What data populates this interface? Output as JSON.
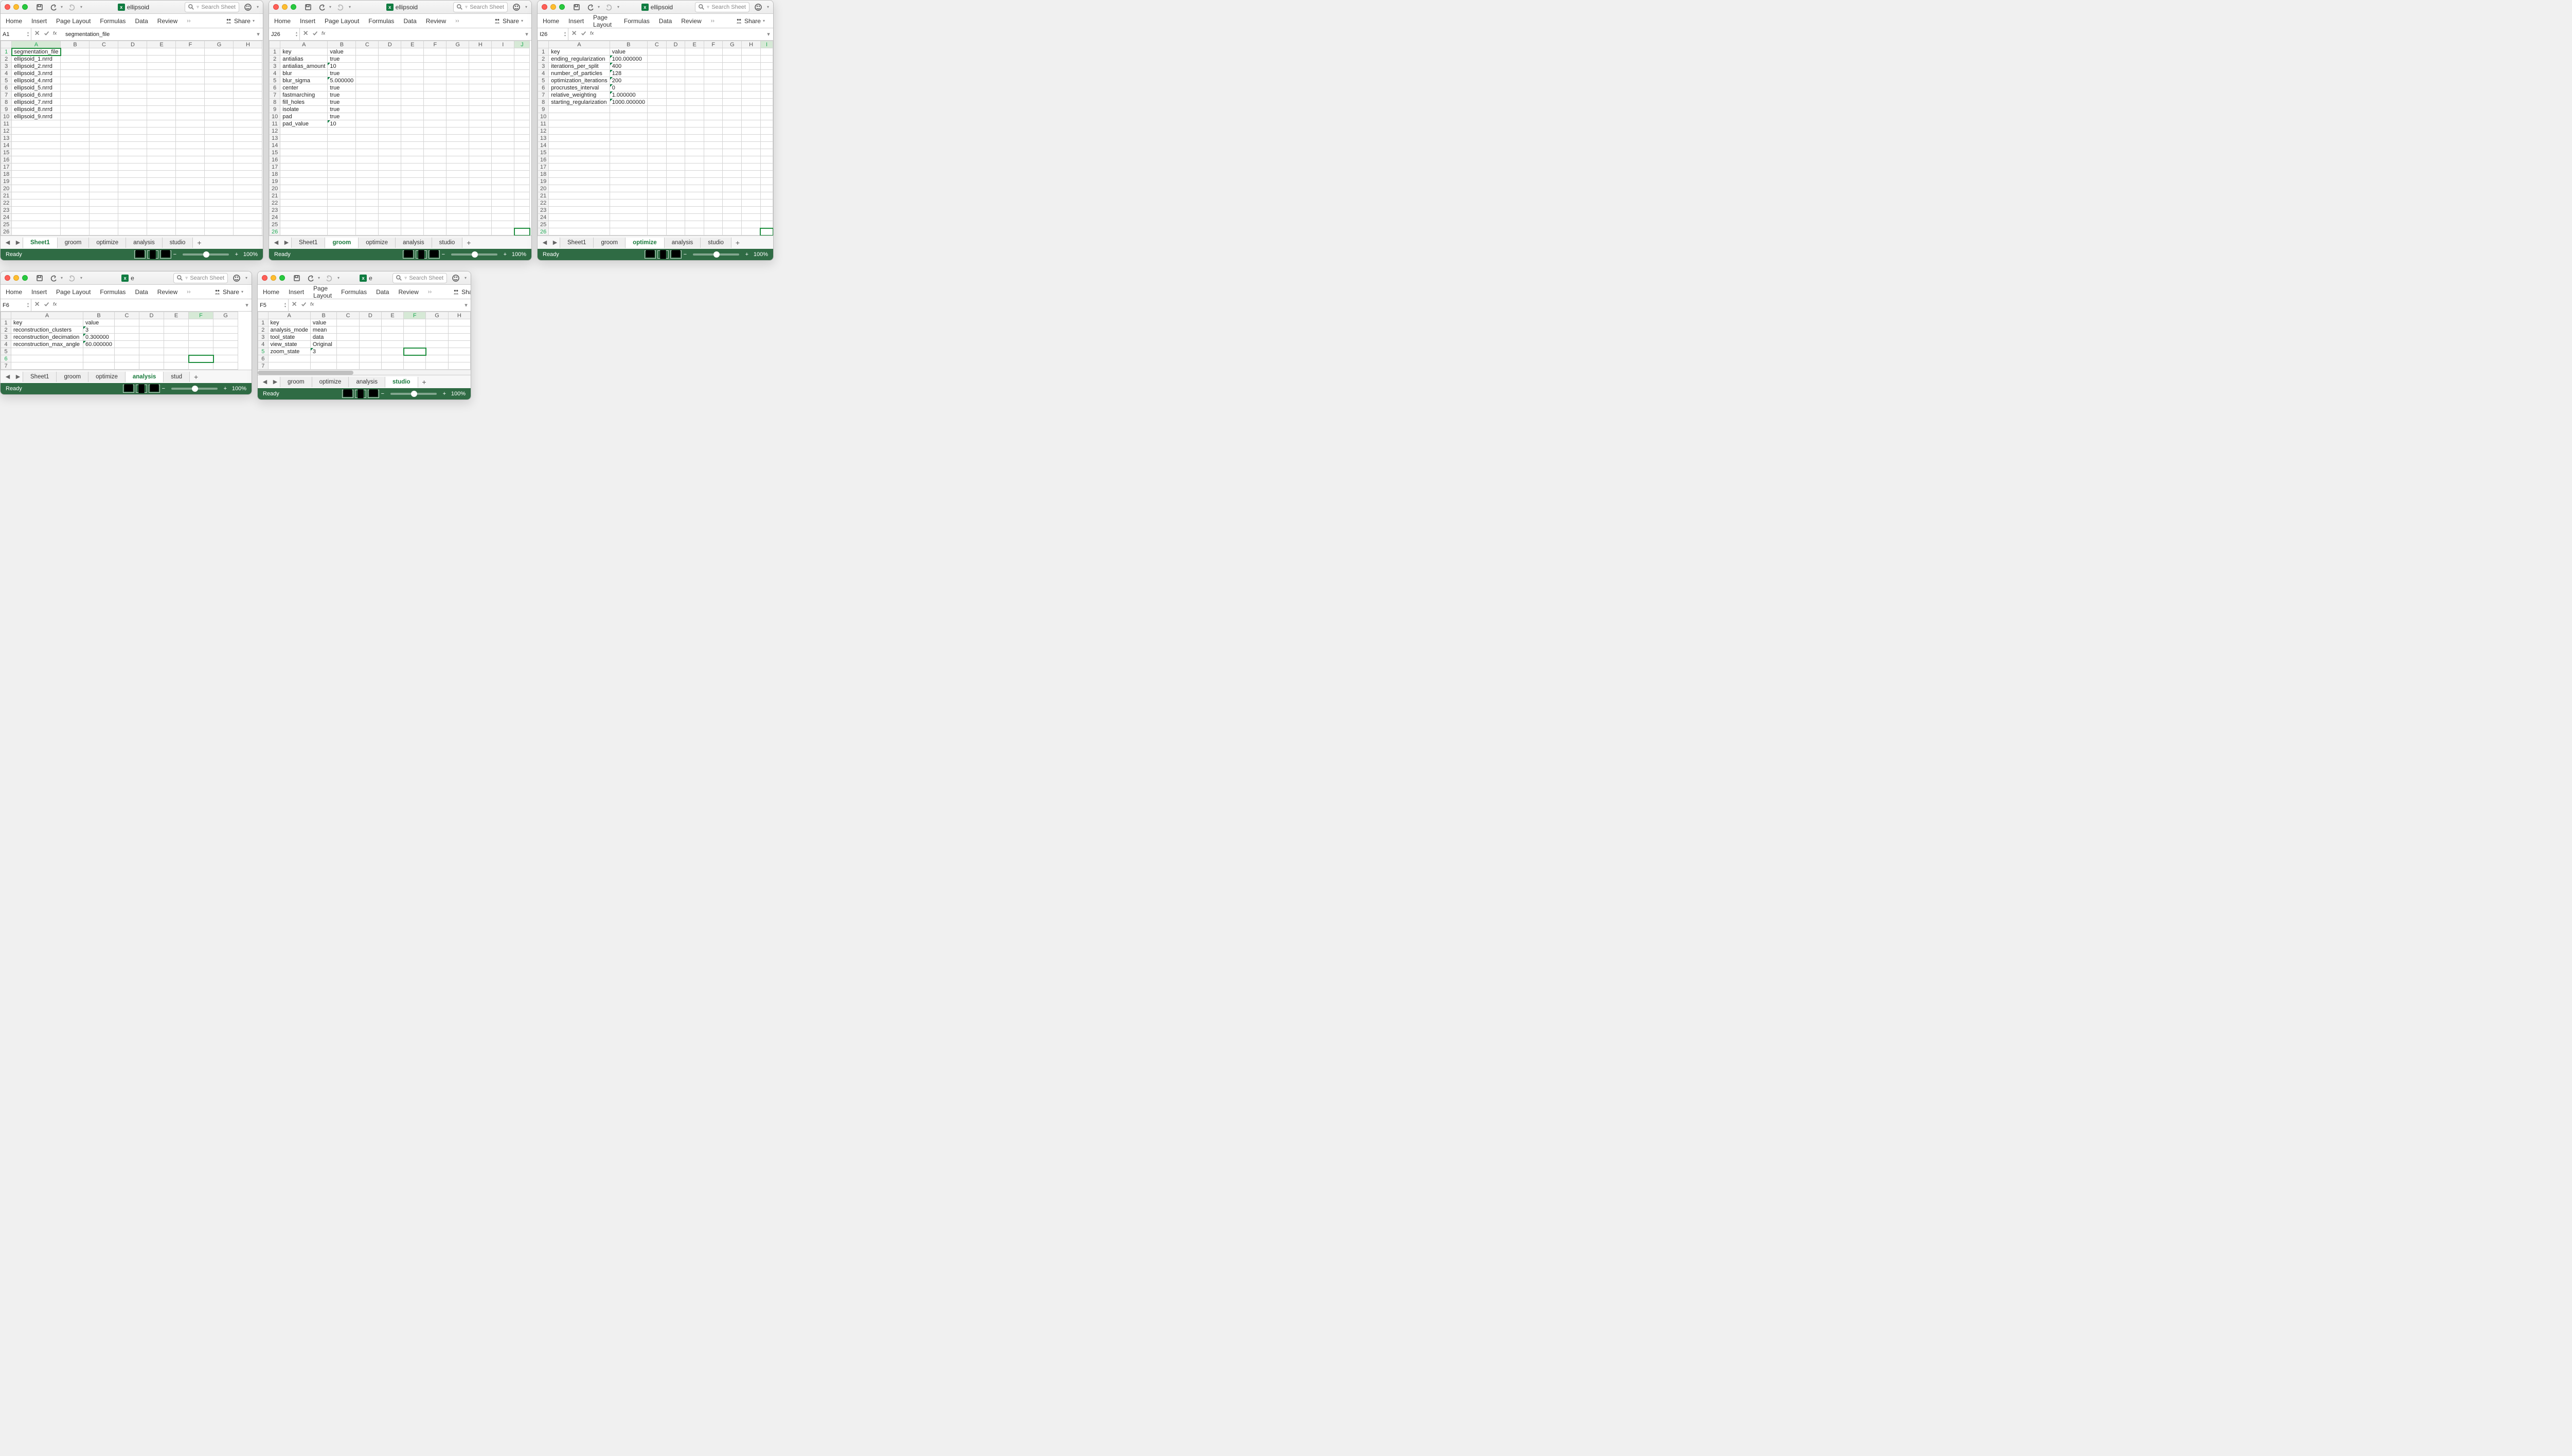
{
  "filename": "ellipsoid",
  "filename_short": "e",
  "search_placeholder": "Search Sheet",
  "ribbon": {
    "tabs": [
      "Home",
      "Insert",
      "Page Layout",
      "Formulas",
      "Data",
      "Review"
    ],
    "share": "Share"
  },
  "status": {
    "ready": "Ready",
    "zoom": "100%"
  },
  "sheet_tabs": [
    "Sheet1",
    "groom",
    "optimize",
    "analysis",
    "studio"
  ],
  "w1": {
    "cellref": "A1",
    "formula": "segmentation_file",
    "active_tab": "Sheet1",
    "cols": [
      "A",
      "B",
      "C",
      "D",
      "E",
      "F",
      "G",
      "H"
    ],
    "rows": 26,
    "data": {
      "1": {
        "A": "segmentation_file"
      },
      "2": {
        "A": "ellipsoid_1.nrrd"
      },
      "3": {
        "A": "ellipsoid_2.nrrd"
      },
      "4": {
        "A": "ellipsoid_3.nrrd"
      },
      "5": {
        "A": "ellipsoid_4.nrrd"
      },
      "6": {
        "A": "ellipsoid_5.nrrd"
      },
      "7": {
        "A": "ellipsoid_6.nrrd"
      },
      "8": {
        "A": "ellipsoid_7.nrrd"
      },
      "9": {
        "A": "ellipsoid_8.nrrd"
      },
      "10": {
        "A": "ellipsoid_9.nrrd"
      }
    },
    "active_cell": "A1"
  },
  "w2": {
    "cellref": "J26",
    "formula": "",
    "active_tab": "groom",
    "cols": [
      "A",
      "B",
      "C",
      "D",
      "E",
      "F",
      "G",
      "H",
      "I",
      "J"
    ],
    "rows": 26,
    "flags": [
      "B3",
      "B5",
      "B11"
    ],
    "data": {
      "1": {
        "A": "key",
        "B": "value"
      },
      "2": {
        "A": "antialias",
        "B": "true"
      },
      "3": {
        "A": "antialias_amount",
        "B": "10"
      },
      "4": {
        "A": "blur",
        "B": "true"
      },
      "5": {
        "A": "blur_sigma",
        "B": "5.000000"
      },
      "6": {
        "A": "center",
        "B": "true"
      },
      "7": {
        "A": "fastmarching",
        "B": "true"
      },
      "8": {
        "A": "fill_holes",
        "B": "true"
      },
      "9": {
        "A": "isolate",
        "B": "true"
      },
      "10": {
        "A": "pad",
        "B": "true"
      },
      "11": {
        "A": "pad_value",
        "B": "10"
      }
    },
    "active_cell": "J26"
  },
  "w3": {
    "cellref": "I26",
    "formula": "",
    "active_tab": "optimize",
    "cols": [
      "A",
      "B",
      "C",
      "D",
      "E",
      "F",
      "G",
      "H",
      "I"
    ],
    "rows": 26,
    "flags": [
      "B2",
      "B3",
      "B4",
      "B5",
      "B6",
      "B7",
      "B8"
    ],
    "data": {
      "1": {
        "A": "key",
        "B": "value"
      },
      "2": {
        "A": "ending_regularization",
        "B": "100.000000"
      },
      "3": {
        "A": "iterations_per_split",
        "B": "400"
      },
      "4": {
        "A": "number_of_particles",
        "B": "128"
      },
      "5": {
        "A": "optimization_iterations",
        "B": "200"
      },
      "6": {
        "A": "procrustes_interval",
        "B": "0"
      },
      "7": {
        "A": "relative_weighting",
        "B": "1.000000"
      },
      "8": {
        "A": "starting_regularization",
        "B": "1000.000000"
      }
    },
    "active_cell": "I26"
  },
  "w4": {
    "cellref": "F6",
    "formula": "",
    "active_tab": "analysis",
    "cols": [
      "A",
      "B",
      "C",
      "D",
      "E",
      "F",
      "G"
    ],
    "rows": 7,
    "flags": [
      "B2",
      "B3",
      "B4"
    ],
    "data": {
      "1": {
        "A": "key",
        "B": "value"
      },
      "2": {
        "A": "reconstruction_clusters",
        "B": "3"
      },
      "3": {
        "A": "reconstruction_decimation",
        "B": "0.300000"
      },
      "4": {
        "A": "reconstruction_max_angle",
        "B": "60.000000"
      }
    },
    "active_cell": "F6",
    "tabs_visible": [
      "Sheet1",
      "groom",
      "optimize",
      "analysis",
      "studio"
    ],
    "truncate_last": "stud"
  },
  "w5": {
    "cellref": "F5",
    "formula": "",
    "active_tab": "studio",
    "cols": [
      "A",
      "B",
      "C",
      "D",
      "E",
      "F",
      "G",
      "H"
    ],
    "rows": 7,
    "flags": [
      "B5"
    ],
    "data": {
      "1": {
        "A": "key",
        "B": "value"
      },
      "2": {
        "A": "analysis_mode",
        "B": "mean"
      },
      "3": {
        "A": "tool_state",
        "B": "data"
      },
      "4": {
        "A": "view_state",
        "B": "Original"
      },
      "5": {
        "A": "zoom_state",
        "B": "3"
      }
    },
    "active_cell": "F5",
    "tabs_visible": [
      "groom",
      "optimize",
      "analysis",
      "studio"
    ]
  }
}
